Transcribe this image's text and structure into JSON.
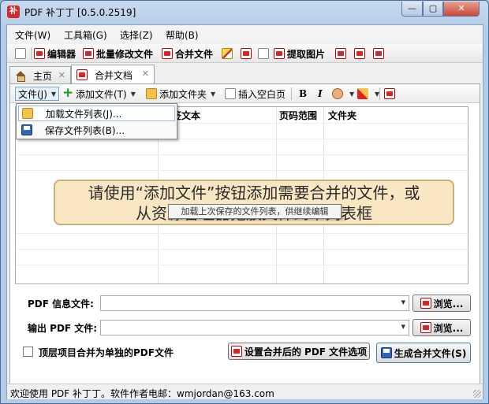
{
  "window": {
    "title": "PDF 补丁丁 [0.5.0.2519]",
    "app_icon": "补"
  },
  "menubar": {
    "items": [
      "文件(W)",
      "工具箱(G)",
      "选择(Z)",
      "帮助(B)"
    ]
  },
  "toolbar": {
    "editor_label": "编辑器",
    "batch_label": "批量修改文件",
    "merge_label": "合并文件",
    "extract_label": "提取图片"
  },
  "tabs": [
    {
      "label": "主页"
    },
    {
      "label": "合并文档"
    }
  ],
  "subtoolbar": {
    "file_label": "文件(J)",
    "add_file_label": "添加文件(T)",
    "add_folder_label": "添加文件夹",
    "insert_blank_label": "插入空白页",
    "bold": "B",
    "italic": "I"
  },
  "dropdown": {
    "items": [
      "加载文件列表(J)...",
      "保存文件列表(B)..."
    ]
  },
  "tooltip": "加载上次保存的文件列表，供继续编辑",
  "grid": {
    "columns": [
      "签文本",
      "页码范围",
      "文件夹"
    ]
  },
  "overlay_hint": {
    "line1": "请使用“添加文件”按钮添加需要合并的文件，或",
    "line2": "从资源管理器拖放文件到本列表框"
  },
  "form": {
    "info_file_label": "PDF 信息文件:",
    "output_file_label": "输出 PDF 文件:",
    "browse_label": "浏览...",
    "checkbox_label": "顶层项目合并为单独的PDF文件",
    "options_button": "设置合并后的 PDF 文件选项",
    "generate_button": "生成合并文件(S)"
  },
  "statusbar": {
    "text": "欢迎使用 PDF 补丁丁。软件作者电邮：wmjordan@163.com"
  }
}
